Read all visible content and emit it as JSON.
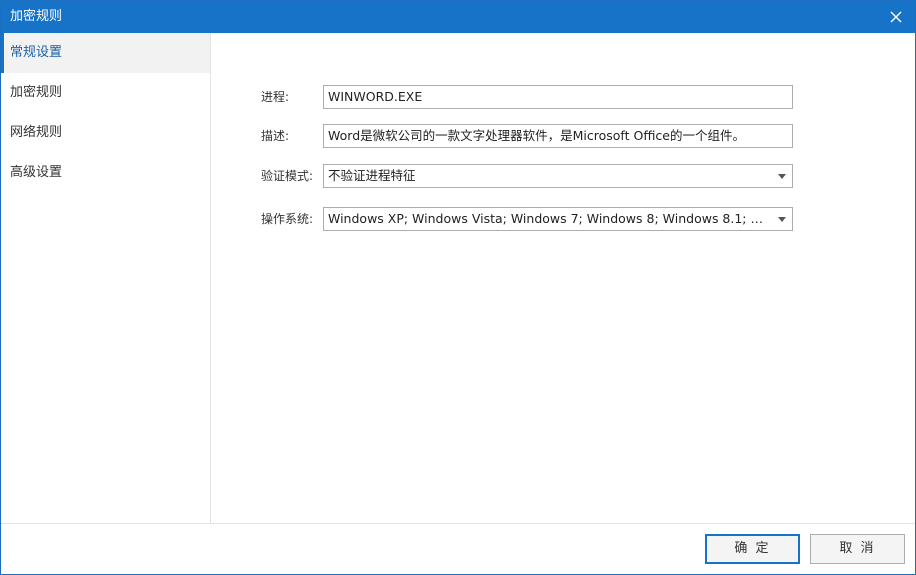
{
  "window": {
    "title": "加密规则",
    "close_icon": "close-icon"
  },
  "sidebar": {
    "items": [
      {
        "label": "常规设置",
        "active": true
      },
      {
        "label": "加密规则",
        "active": false
      },
      {
        "label": "网络规则",
        "active": false
      },
      {
        "label": "高级设置",
        "active": false
      }
    ]
  },
  "form": {
    "process": {
      "label": "进程:",
      "value": "WINWORD.EXE"
    },
    "description": {
      "label": "描述:",
      "value": "Word是微软公司的一款文字处理器软件，是Microsoft Office的一个组件。"
    },
    "verify_mode": {
      "label": "验证模式:",
      "value": "不验证进程特征",
      "icon": "chevron-down-icon"
    },
    "os": {
      "label": "操作系统:",
      "value": "Windows XP; Windows Vista; Windows 7; Windows 8; Windows 8.1; Windo...",
      "icon": "chevron-down-icon"
    }
  },
  "footer": {
    "ok_label": "确 定",
    "cancel_label": "取 消"
  },
  "colors": {
    "titlebar": "#1673c7",
    "active_text": "#1c5fa8",
    "border": "#abadb3"
  }
}
